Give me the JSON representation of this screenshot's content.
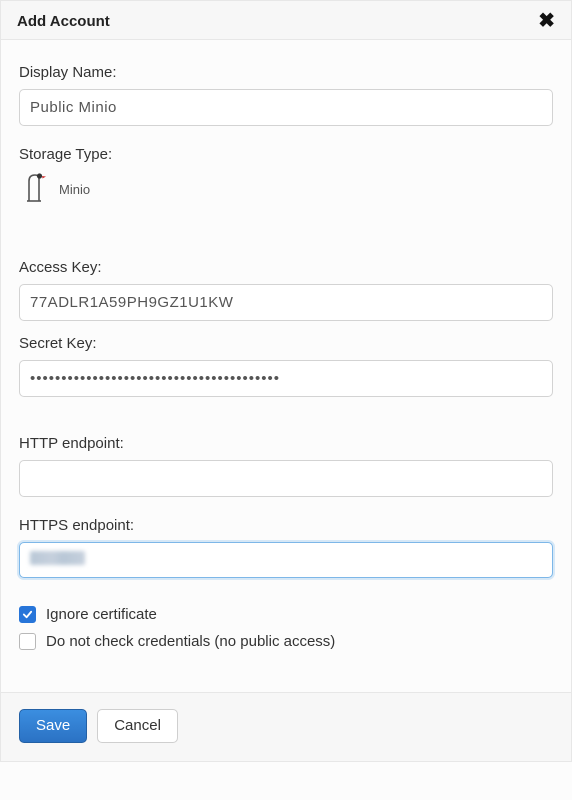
{
  "modal": {
    "title": "Add Account"
  },
  "fields": {
    "display_name": {
      "label": "Display Name:",
      "value": "Public Minio"
    },
    "storage_type": {
      "label": "Storage Type:",
      "value": "Minio",
      "icon": "minio-bird-icon"
    },
    "access_key": {
      "label": "Access Key:",
      "value": "77ADLR1A59PH9GZ1U1KW"
    },
    "secret_key": {
      "label": "Secret Key:",
      "value": "••••••••••••••••••••••••••••••••••••••••"
    },
    "http_endpoint": {
      "label": "HTTP endpoint:",
      "value": ""
    },
    "https_endpoint": {
      "label": "HTTPS endpoint:",
      "value": ""
    }
  },
  "checks": {
    "ignore_cert": {
      "label": "Ignore certificate",
      "checked": true
    },
    "no_check_creds": {
      "label": "Do not check credentials (no public access)",
      "checked": false
    }
  },
  "buttons": {
    "save": "Save",
    "cancel": "Cancel"
  }
}
